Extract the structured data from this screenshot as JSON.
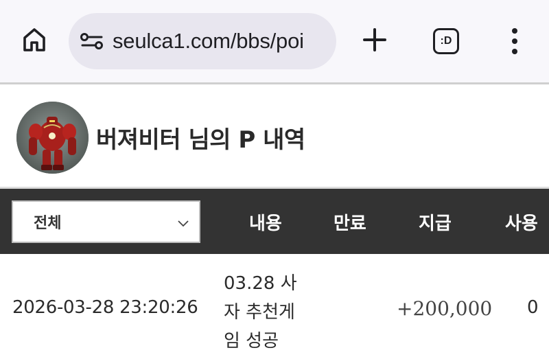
{
  "browser": {
    "url": "seulca1.com/bbs/poi",
    "tabs_icon_text": ":D",
    "icons": [
      "home-icon",
      "site-settings-icon",
      "plus-icon",
      "tab-switcher-icon",
      "more-vert-icon"
    ]
  },
  "header": {
    "title": "버져비터 님의 P 내역",
    "avatar": "avatar-robot-image"
  },
  "table": {
    "filter": {
      "selected": "전체"
    },
    "columns": [
      "내용",
      "만료",
      "지급",
      "사용"
    ],
    "rows": [
      {
        "date": "2026-03-28 23:20:26",
        "content": "03.28 사자 추천게임 성공",
        "expire": "",
        "grant": "+200,000",
        "use": "0"
      }
    ]
  },
  "colors": {
    "browser_bg": "#f8f7fb",
    "url_pill_bg": "#e8e6ef",
    "table_header_bg": "#333333",
    "table_header_text": "#ffffff"
  }
}
